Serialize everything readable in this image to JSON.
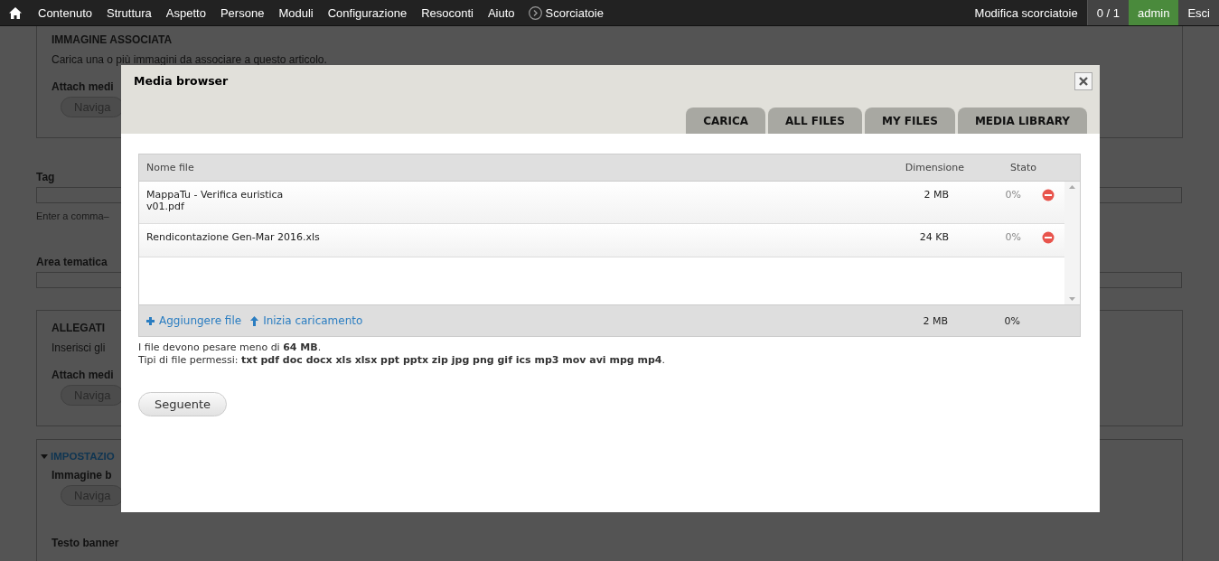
{
  "toolbar": {
    "items": [
      {
        "label": "Contenuto"
      },
      {
        "label": "Struttura"
      },
      {
        "label": "Aspetto"
      },
      {
        "label": "Persone"
      },
      {
        "label": "Moduli"
      },
      {
        "label": "Configurazione"
      },
      {
        "label": "Resoconti"
      },
      {
        "label": "Aiuto"
      }
    ],
    "shortcuts": "Scorciatoie",
    "right": [
      {
        "kind": "link",
        "label": "Modifica scorciatoie"
      },
      {
        "kind": "counter",
        "label": "0 / 1"
      },
      {
        "kind": "user",
        "label": "admin"
      },
      {
        "kind": "logout",
        "label": "Esci"
      }
    ]
  },
  "background_page": {
    "sections": [
      {
        "kind": "fieldset",
        "title": "IMMAGINE ASSOCIATA",
        "description": "Carica una o più immagini da associare a questo articolo.",
        "field_label": "Attach medi",
        "button": "Naviga"
      },
      {
        "kind": "field",
        "label": "Tag",
        "help": "Enter a comma–"
      },
      {
        "kind": "field",
        "label": "Area tematica"
      },
      {
        "kind": "fieldset",
        "title": "ALLEGATI",
        "description": "Inserisci gli",
        "field_label": "Attach medi",
        "button": "Naviga"
      },
      {
        "kind": "collapsible",
        "title": "IMPOSTAZIO",
        "expanded": true,
        "field_label": "Immagine b",
        "button": "Naviga",
        "extra_label": "Testo banner"
      }
    ]
  },
  "dialog": {
    "title": "Media browser",
    "tabs": [
      {
        "label": "CARICA"
      },
      {
        "label": "ALL FILES"
      },
      {
        "label": "MY FILES"
      },
      {
        "label": "MEDIA LIBRARY"
      }
    ],
    "columns": [
      "Nome file",
      "Dimensione",
      "Stato"
    ],
    "rows": [
      {
        "name": "MappaTu - Verifica euristica\nv01.pdf",
        "size": "2 MB",
        "status": "0%"
      },
      {
        "name": "Rendicontazione Gen-Mar 2016.xls",
        "size": "24 KB",
        "status": "0%"
      }
    ],
    "footer": {
      "add": "Aggiungere file",
      "start": "Inizia caricamento",
      "total_size": "2 MB",
      "total_status": "0%"
    },
    "notes": [
      "I file devono pesare meno di **64 MB**.",
      "Tipi di file permessi: **txt pdf doc docx xls xlsx ppt pptx zip jpg png gif ics mp3 mov avi mpg mp4**."
    ],
    "next_button": "Seguente"
  }
}
